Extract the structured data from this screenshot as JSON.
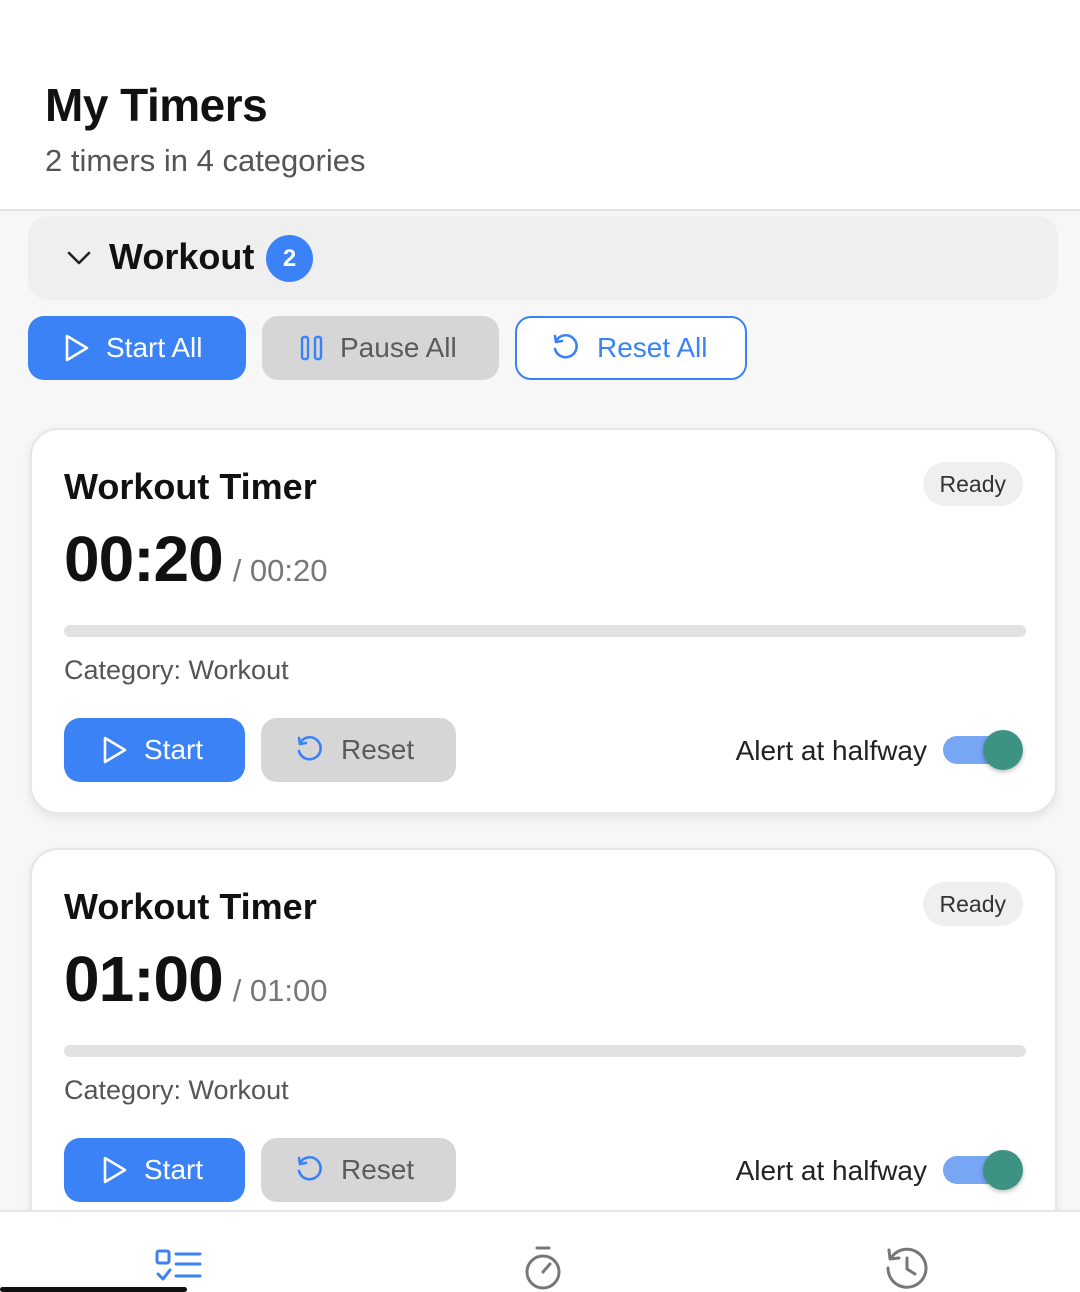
{
  "header": {
    "title": "My Timers",
    "subtitle": "2 timers in 4 categories"
  },
  "category": {
    "name": "Workout",
    "count": "2",
    "expanded": true
  },
  "bulk_actions": {
    "start_all": "Start All",
    "pause_all": "Pause All",
    "reset_all": "Reset All"
  },
  "timers": [
    {
      "title": "Workout Timer",
      "status": "Ready",
      "time": "00:20",
      "total": "/ 00:20",
      "progress": 0,
      "category": "Category: Workout",
      "start_label": "Start",
      "reset_label": "Reset",
      "alert_label": "Alert at halfway",
      "alert_enabled": true
    },
    {
      "title": "Workout Timer",
      "status": "Ready",
      "time": "01:00",
      "total": "/ 01:00",
      "progress": 0,
      "category": "Category: Workout",
      "start_label": "Start",
      "reset_label": "Reset",
      "alert_label": "Alert at halfway",
      "alert_enabled": true
    }
  ],
  "tabs": [
    {
      "icon": "timers-list-icon",
      "active": true
    },
    {
      "icon": "stopwatch-icon",
      "active": false
    },
    {
      "icon": "history-icon",
      "active": false
    }
  ],
  "colors": {
    "accent": "#3b82f6",
    "toggle_knob": "#3c9283",
    "toggle_track": "#77a6f5"
  }
}
